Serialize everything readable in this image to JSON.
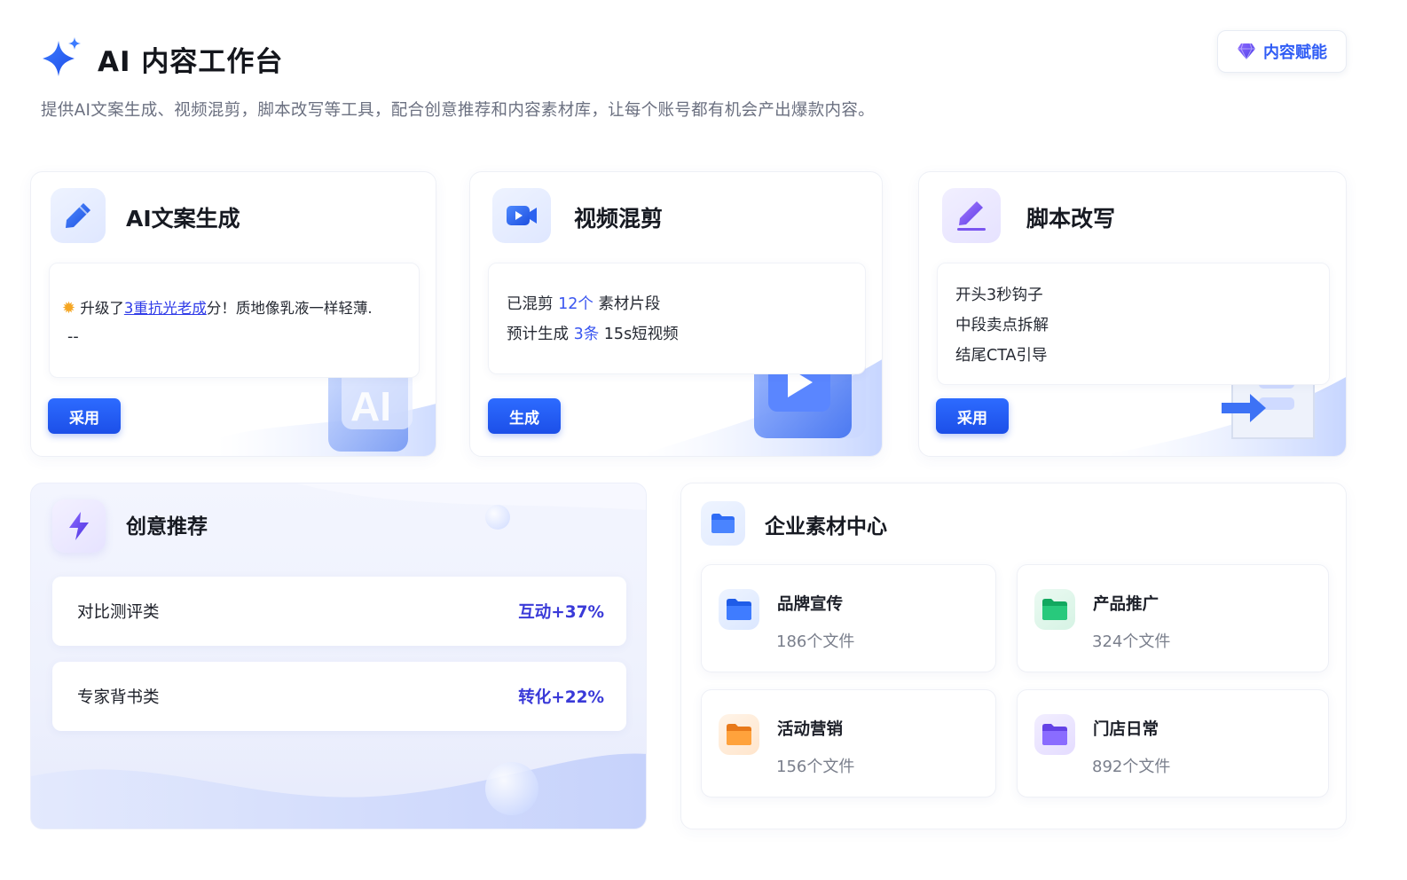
{
  "header": {
    "title": "AI 内容工作台",
    "subtitle": "提供AI文案生成、视频混剪，脚本改写等工具，配合创意推荐和内容素材库，让每个账号都有机会产出爆款内容。",
    "empower_button": "内容赋能",
    "icon": "sparkle-icon"
  },
  "tools": [
    {
      "title": "AI文案生成",
      "icon": "pen-icon",
      "preview_prefix": "升级了",
      "preview_link": "3重抗光老成",
      "preview_suffix": "分！质地像乳液一样轻薄.",
      "preview_line2": "--",
      "button": "采用",
      "deco_text": "AI"
    },
    {
      "title": "视频混剪",
      "icon": "video-icon",
      "line1_prefix": "已混剪",
      "line1_highlight": "12个",
      "line1_suffix": "素材片段",
      "line2_prefix": "预计生成",
      "line2_highlight": "3条",
      "line2_suffix": "15s短视频",
      "button": "生成"
    },
    {
      "title": "脚本改写",
      "icon": "edit-script-icon",
      "lines": [
        "开头3秒钩子",
        "中段卖点拆解",
        "结尾CTA引导"
      ],
      "button": "采用"
    }
  ],
  "creative": {
    "title": "创意推荐",
    "icon": "lightning-icon",
    "items": [
      {
        "label": "对比测评类",
        "stat": "互动+37%"
      },
      {
        "label": "专家背书类",
        "stat": "转化+22%"
      }
    ]
  },
  "assets": {
    "title": "企业素材中心",
    "icon": "folder-icon",
    "folders": [
      {
        "name": "品牌宣传",
        "count": "186个文件",
        "color": "#2f6cf5"
      },
      {
        "name": "产品推广",
        "count": "324个文件",
        "color": "#1fbf72"
      },
      {
        "name": "活动营销",
        "count": "156个文件",
        "color": "#f5902a"
      },
      {
        "name": "门店日常",
        "count": "892个文件",
        "color": "#7c5cf0"
      }
    ]
  },
  "colors": {
    "primary": "#2563f0",
    "highlight": "#3a56f0",
    "stat": "#3a3ad8"
  }
}
